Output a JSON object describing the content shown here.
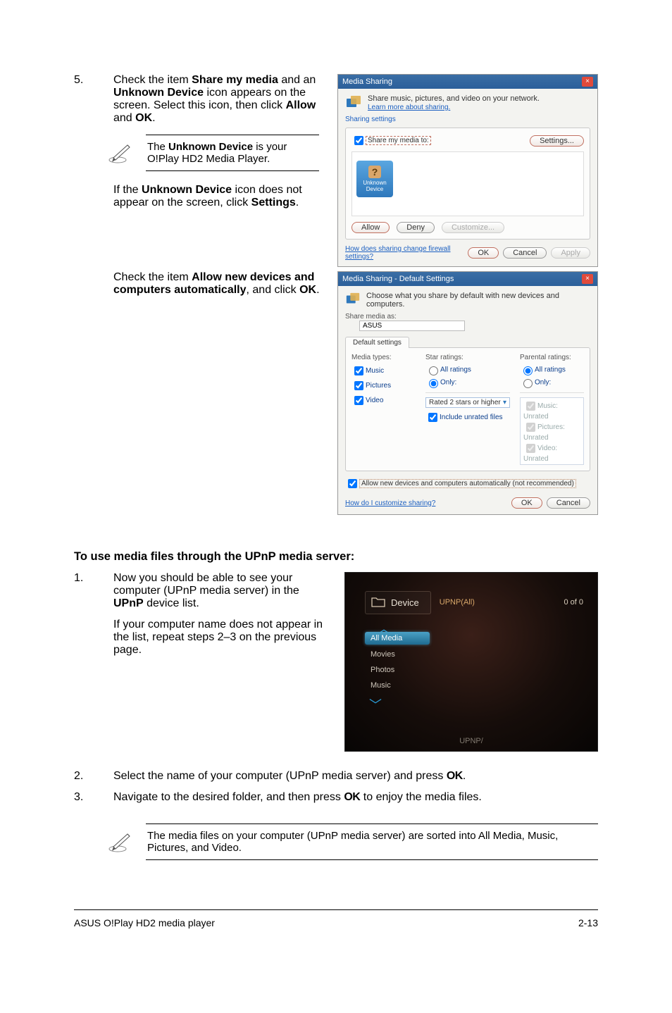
{
  "steps": {
    "s5": {
      "num": "5.",
      "p1a": "Check the item ",
      "p1b": "Share my media",
      "p1c": " and an ",
      "p1d": "Unknown Device",
      "p1e": " icon appears on the screen. Select this icon, then click ",
      "p1f": "Allow",
      "p1g": " and ",
      "p1h": "OK",
      "p1i": ".",
      "note_a": "The ",
      "note_b": "Unknown Device",
      "note_c": " is your O!Play HD2 Media Player.",
      "p2a": "If the ",
      "p2b": "Unknown Device",
      "p2c": " icon does not appear on the screen, click ",
      "p2d": "Settings",
      "p2e": ".",
      "p3a": "Check the item ",
      "p3b": "Allow new devices and computers automatically",
      "p3c": ", and click ",
      "p3d": "OK",
      "p3e": "."
    },
    "s1": {
      "num": "1.",
      "p1a": "Now you should be able to see your computer (UPnP media server) in the ",
      "p1b": "UPnP",
      "p1c": " device list.",
      "p2": "If your computer name does not appear in the list, repeat steps 2–3 on the previous page."
    },
    "s2": {
      "num": "2.",
      "text_a": "Select the name of your computer (UPnP media server) and press ",
      "text_b": "."
    },
    "s3": {
      "num": "3.",
      "text_a": "Navigate to the desired folder, and then press ",
      "text_b": " to enjoy the media files."
    }
  },
  "ok_key": "OK",
  "section_heading": "To use media files through the UPnP media server:",
  "final_note": "The media files on your computer (UPnP media server) are sorted into All Media, Music, Pictures, and Video.",
  "footer": {
    "left": "ASUS O!Play HD2 media player",
    "right": "2-13"
  },
  "media_sharing": {
    "title": "Media Sharing",
    "desc": "Share music, pictures, and video on your network.",
    "learn_link": "Learn more about sharing.",
    "sharing_settings": "Sharing settings",
    "share_checkbox": "Share my media to:",
    "settings_btn": "Settings...",
    "device_label": "Unknown Device",
    "allow_btn": "Allow",
    "deny_btn": "Deny",
    "customize_btn": "Customize...",
    "firewall_text": "How does sharing change firewall settings?",
    "ok_btn": "OK",
    "cancel_btn": "Cancel",
    "apply_btn": "Apply"
  },
  "default_settings": {
    "title": "Media Sharing - Default Settings",
    "desc": "Choose what you share by default with new devices and computers.",
    "share_as_lbl": "Share media as:",
    "share_as_val": "ASUS",
    "tab": "Default settings",
    "media_types_hd": "Media types:",
    "mt_music": "Music",
    "mt_pictures": "Pictures",
    "mt_video": "Video",
    "star_hd": "Star ratings:",
    "star_all": "All ratings",
    "star_only": "Only:",
    "star_rated": "Rated 2 stars or higher",
    "star_include": "Include unrated files",
    "parental_hd": "Parental ratings:",
    "par_all": "All ratings",
    "par_only": "Only:",
    "par_music": "Music: Unrated",
    "par_pic": "Pictures: Unrated",
    "par_vid": "Video: Unrated",
    "allow_new": "Allow new devices and computers automatically (not recommended)",
    "how_link": "How do I customize sharing?",
    "ok_btn": "OK",
    "cancel_btn": "Cancel"
  },
  "oplay": {
    "device": "Device",
    "name": "UPNP(All)",
    "count": "0 of 0",
    "allmedia": "All Media",
    "movies": "Movies",
    "photos": "Photos",
    "music": "Music",
    "footer": "UPNP/"
  }
}
